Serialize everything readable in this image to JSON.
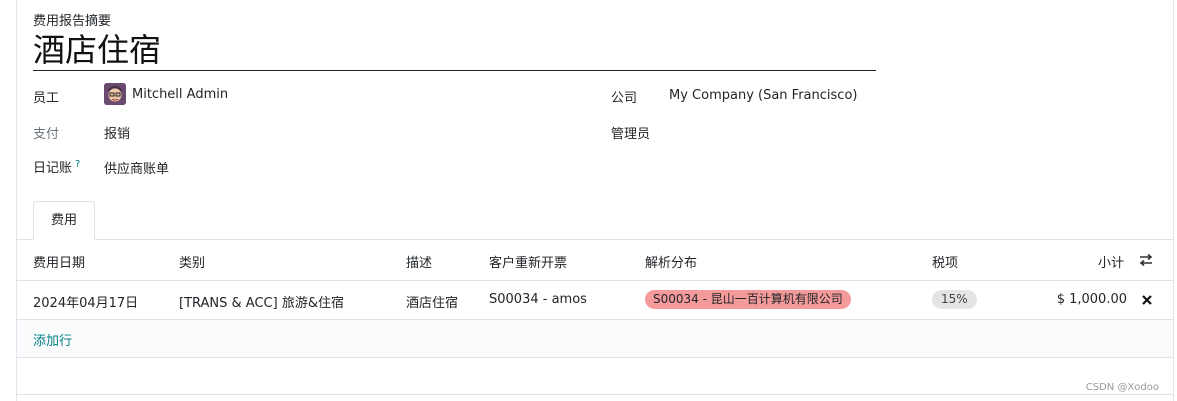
{
  "form": {
    "breadcrumb_label": "费用报告摘要",
    "title": "酒店住宿",
    "fields": {
      "employee_label": "员工",
      "employee_value": "Mitchell Admin",
      "payment_label": "支付",
      "payment_value": "报销",
      "journal_label": "日记账",
      "journal_help": "?",
      "journal_value": "供应商账单",
      "company_label": "公司",
      "company_value": "My Company (San Francisco)",
      "manager_label": "管理员"
    }
  },
  "tabs": [
    {
      "label": "费用"
    }
  ],
  "table": {
    "headers": {
      "date": "费用日期",
      "category": "类别",
      "description": "描述",
      "reinvoice": "客户重新开票",
      "analytic": "解析分布",
      "tax": "税项",
      "subtotal": "小计"
    },
    "rows": [
      {
        "date": "2024年04月17日",
        "category": "[TRANS & ACC] 旅游&住宿",
        "description": "酒店住宿",
        "reinvoice": "S00034 - amos",
        "analytic": "S00034 - 昆山一百计算机有限公司",
        "tax": "15%",
        "subtotal": "$ 1,000.00"
      }
    ],
    "add_line": "添加行"
  },
  "watermark": "CSDN @Xodoo",
  "colors": {
    "link": "#017e84",
    "analytic_tag": "#f49a9a",
    "tax_tag": "#e4e4e4",
    "help_mark": "#017e84"
  },
  "icons": [
    "optional-columns-icon",
    "delete-row-icon",
    "avatar"
  ]
}
